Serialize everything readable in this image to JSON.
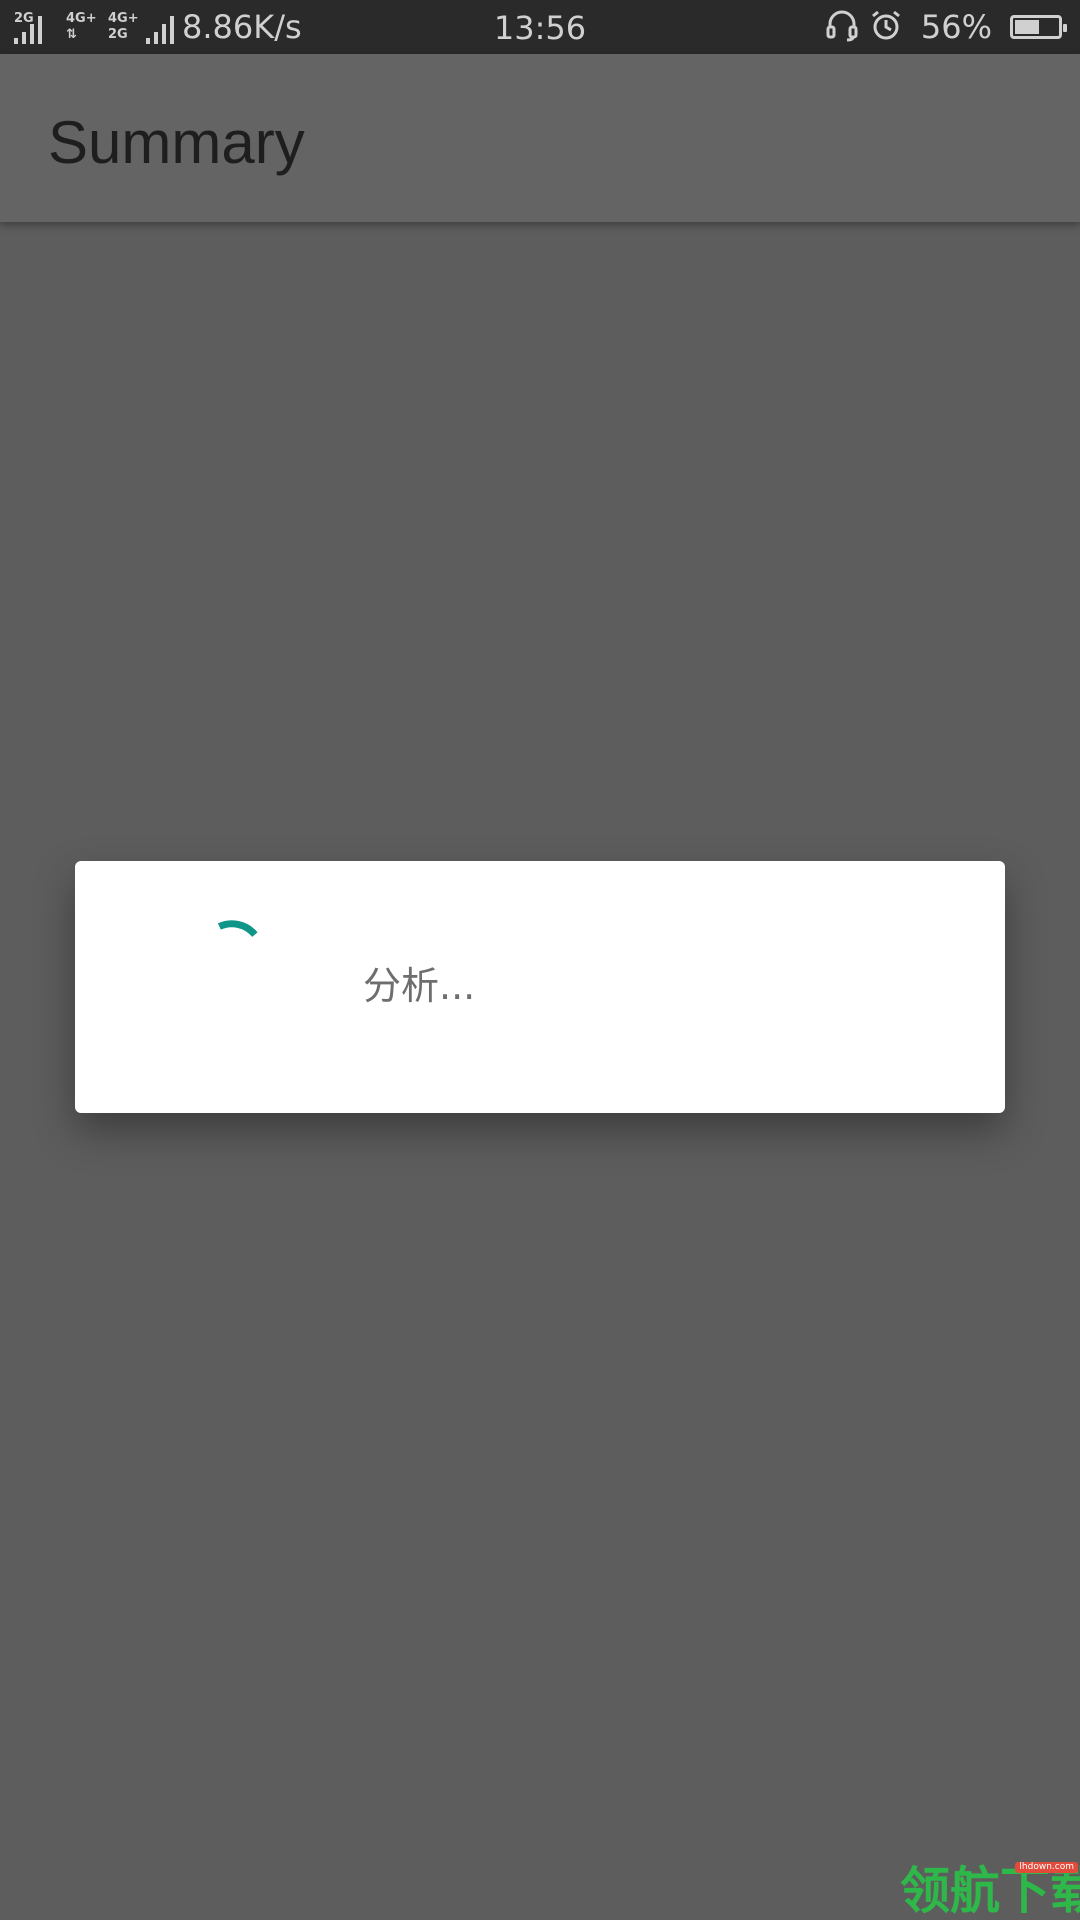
{
  "status_bar": {
    "sim1_network": "2G",
    "sim2_network_top": "4G+",
    "sim2_network_bottom": "4G+",
    "sim2_network_sub": "2G",
    "net_speed": "8.86K/s",
    "time": "13:56",
    "battery_percent": "56%",
    "battery_level": 0.56,
    "icons": [
      "headset-icon",
      "alarm-icon",
      "battery-icon"
    ]
  },
  "app_bar": {
    "title": "Summary"
  },
  "dialog": {
    "message": "分析...",
    "spinner_color": "#0f9688"
  },
  "watermark": {
    "text": "领航下载",
    "tag": "lhdown.com"
  },
  "colors": {
    "status_bar_bg": "#2a2a2a",
    "app_bar_bg": "#646464",
    "scrim_bg": "#5d5d5d",
    "dialog_bg": "#ffffff",
    "accent": "#0f9688"
  }
}
